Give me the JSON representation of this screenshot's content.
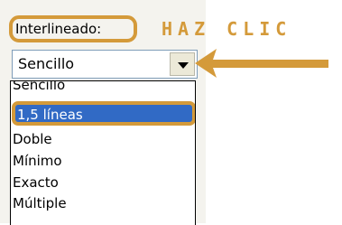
{
  "dialog": {
    "spacing_label": "Interlineado:",
    "annotation": "HAZ CLIC",
    "combo_value": "Sencillo",
    "options": [
      "Sencillo",
      "1,5 líneas",
      "Doble",
      "Mínimo",
      "Exacto",
      "Múltiple"
    ],
    "selected_option": "1,5 líneas"
  },
  "colors": {
    "highlight": "#316ac5",
    "annotation_orange": "#d49a3a"
  },
  "icons": [
    "chevron-down-icon",
    "left-arrow-icon"
  ]
}
